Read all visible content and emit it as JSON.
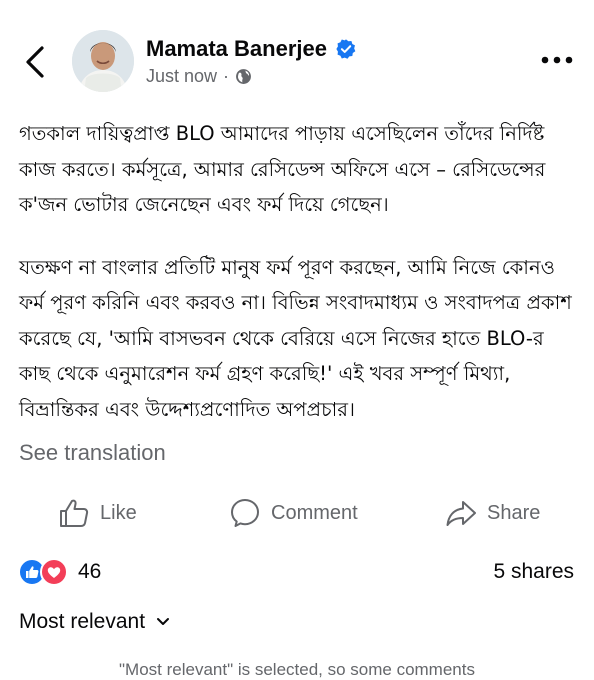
{
  "post": {
    "author": "Mamata Banerjee",
    "timestamp": "Just now",
    "separator": "·",
    "paragraphs": [
      "গতকাল দায়িত্বপ্রাপ্ত BLO আমাদের পাড়ায় এসেছিলেন তাঁদের নির্দিষ্ট কাজ করতে। কর্মসূত্রে, আমার রেসিডেন্স অফিসে এসে – রেসিডেন্সের ক'জন ভোটার জেনেছেন এবং ফর্ম দিয়ে গেছেন।",
      "যতক্ষণ না বাংলার প্রতিটি মানুষ ফর্ম পূরণ করছেন, আমি নিজে কোনও ফর্ম পূরণ করিনি এবং করবও না। বিভিন্ন সংবাদমাধ্যম ও সংবাদপত্র প্রকাশ করেছে যে, 'আমি বাসভবন থেকে বেরিয়ে এসে নিজের হাতে BLO-র কাছ থেকে এনুমারেশন ফর্ম গ্রহণ করেছি!' এই খবর সম্পূর্ণ মিথ্যা, বিভ্রান্তিকর এবং উদ্দেশ্যপ্রণোদিত অপপ্রচার।"
    ],
    "see_translation": "See translation"
  },
  "actions": {
    "like": "Like",
    "comment": "Comment",
    "share": "Share"
  },
  "stats": {
    "reaction_count": "46",
    "shares": "5 shares"
  },
  "comments": {
    "sort_label": "Most relevant",
    "note": "\"Most relevant\" is selected, so some comments"
  },
  "icons": [
    "back-arrow-icon",
    "verified-badge-icon",
    "globe-icon",
    "more-options-icon",
    "like-thumb-icon",
    "comment-bubble-icon",
    "share-arrow-icon",
    "like-reaction-icon",
    "love-reaction-icon",
    "chevron-down-icon"
  ],
  "colors": {
    "verified": "#1877f2",
    "like": "#1877f2",
    "love": "#f33e58",
    "muted": "#65676b",
    "text": "#080809"
  }
}
